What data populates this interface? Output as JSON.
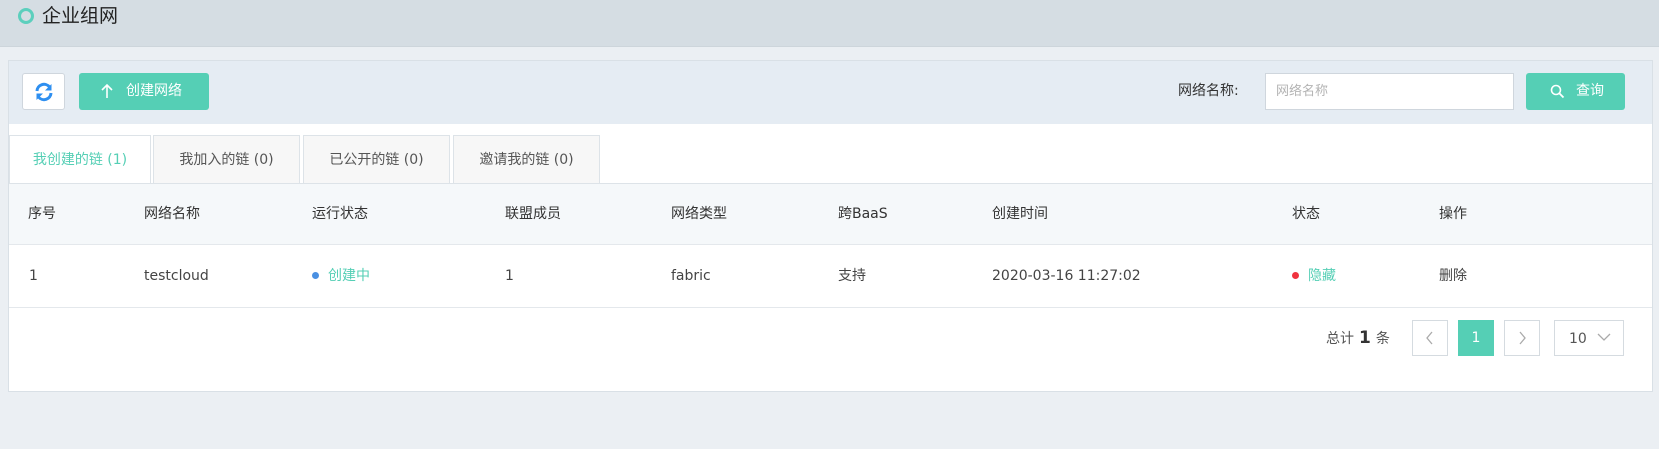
{
  "page": {
    "title": "企业组网"
  },
  "toolbar": {
    "create_label": "创建网络",
    "search_label": "网络名称:",
    "search_placeholder": "网络名称",
    "search_value": "",
    "query_label": "查询"
  },
  "tabs": [
    {
      "label": "我创建的链 (1)",
      "active": true
    },
    {
      "label": "我加入的链 (0)",
      "active": false
    },
    {
      "label": "已公开的链 (0)",
      "active": false
    },
    {
      "label": "邀请我的链 (0)",
      "active": false
    }
  ],
  "table": {
    "headers": [
      "序号",
      "网络名称",
      "运行状态",
      "联盟成员",
      "网络类型",
      "跨BaaS",
      "创建时间",
      "状态",
      "操作"
    ],
    "rows": [
      {
        "index": "1",
        "name": "testcloud",
        "run_status": "创建中",
        "members": "1",
        "type": "fabric",
        "cross_baas": "支持",
        "created": "2020-03-16 11:27:02",
        "status": "隐藏",
        "action": "删除"
      }
    ]
  },
  "pagination": {
    "total_prefix": "总计",
    "total": "1",
    "total_suffix": "条",
    "current_page": "1",
    "page_size": "10"
  },
  "colors": {
    "accent": "#55cfb5",
    "running_dot": "#4a90e2",
    "hidden_dot": "#f0333f"
  }
}
